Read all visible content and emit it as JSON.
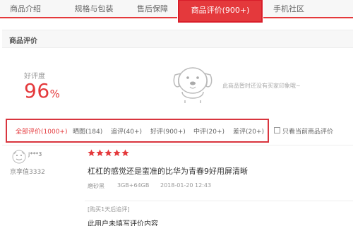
{
  "tabs": [
    {
      "label": "商品介绍"
    },
    {
      "label": "规格与包装"
    },
    {
      "label": "售后保障"
    },
    {
      "label": "商品评价(900+)"
    },
    {
      "label": "手机社区"
    }
  ],
  "section": {
    "title": "商品评价"
  },
  "rating": {
    "label": "好评度",
    "value": "96",
    "unit": "%"
  },
  "mascot": {
    "icon": "jd-dog-mascot-icon",
    "note": "此商品暂时还没有买家印象哦~"
  },
  "filters": [
    {
      "label": "全部评价(1000+)"
    },
    {
      "label": "晒图(184)"
    },
    {
      "label": "追评(40+)"
    },
    {
      "label": "好评(900+)"
    },
    {
      "label": "中评(20+)"
    },
    {
      "label": "差评(20+)"
    }
  ],
  "current_only": {
    "label": "只看当前商品评价",
    "checked": false
  },
  "review": {
    "username": "j***3",
    "level": "京享值3332",
    "stars": 5,
    "text": "杠杠的感觉还是蛮准的比华为青春9好用屏清晰",
    "color": "磨砂黑",
    "spec": "3GB+64GB",
    "time": "2018-01-20 12:43",
    "followup_label": "[购买1天后追评]",
    "followup_text": "此用户未填写评价内容"
  },
  "colors": {
    "accent": "#e4393c",
    "tab_bg": "#f7f7f7"
  }
}
